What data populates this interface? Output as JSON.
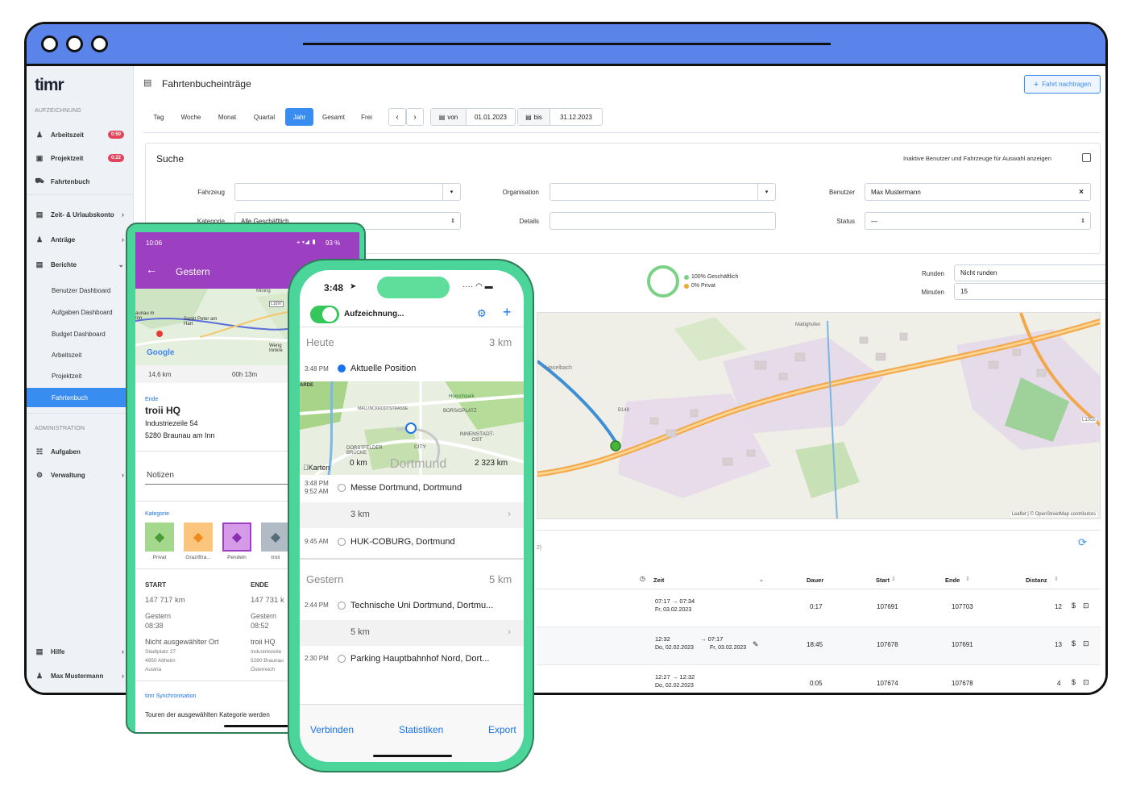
{
  "sidebar": {
    "logo": "timr",
    "section_recording": "AUFZEICHNUNG",
    "items": [
      {
        "label": "Arbeitszeit",
        "badge": "0:50"
      },
      {
        "label": "Projektzeit",
        "badge": "0:22"
      },
      {
        "label": "Fahrtenbuch"
      },
      {
        "label": "Zeit- & Urlaubskonto"
      },
      {
        "label": "Anträge"
      },
      {
        "label": "Berichte"
      }
    ],
    "report_items": [
      "Benutzer Dashboard",
      "Aufgaben Dashboard",
      "Budget Dashboard",
      "Arbeitszeit",
      "Projektzeit",
      "Fahrtenbuch"
    ],
    "section_admin": "ADMINISTRATION",
    "admin_items": [
      "Aufgaben",
      "Verwaltung"
    ],
    "help": "Hilfe",
    "user": "Max Mustermann"
  },
  "header": {
    "title": "Fahrtenbucheinträge",
    "add_button": "Fahrt nachtragen"
  },
  "period_tabs": [
    "Tag",
    "Woche",
    "Monat",
    "Quartal",
    "Jahr",
    "Gesamt",
    "Frei"
  ],
  "active_tab": "Jahr",
  "date_range": {
    "from_label": "von",
    "from": "01.01.2023",
    "to_label": "bis",
    "to": "31.12.2023"
  },
  "search": {
    "title": "Suche",
    "inactive_label": "Inaktive Benutzer und Fahrzeuge für Auswahl anzeigen",
    "vehicle_label": "Fahrzeug",
    "category_label": "Kategorie",
    "category_value": "Alle Geschäftlich",
    "organisation_label": "Organisation",
    "details_label": "Details",
    "user_label": "Benutzer",
    "user_value": "Max Mustermann",
    "status_label": "Status",
    "status_value": "—"
  },
  "summary": {
    "business": "100% Geschäftlich",
    "private": "0% Privat",
    "rounding_label": "Runden",
    "rounding_value": "Nicht runden",
    "minutes_label": "Minuten",
    "minutes_value": "15"
  },
  "map": {
    "labels": [
      "Haselbach",
      "Mattighofen",
      "Weng",
      "Innkreis",
      "B148",
      "L1055"
    ],
    "attribution": "Leaflet | © OpenStreetMap contributors"
  },
  "table": {
    "count_suffix": "2)",
    "columns": [
      "Zeit",
      "Dauer",
      "Start",
      "Ende",
      "Distanz"
    ],
    "rows": [
      {
        "time": "07:17 → 07:34",
        "date": "Fr, 03.02.2023",
        "duration": "0:17",
        "start": "107691",
        "end": "107703",
        "distance": "12"
      },
      {
        "time": "12:32",
        "time_end": "→ 07:17",
        "date": "Do, 02.02.2023",
        "date_end": "Fr, 03.02.2023",
        "duration": "18:45",
        "start": "107678",
        "end": "107691",
        "distance": "13"
      },
      {
        "time": "12:27 → 12:32",
        "date": "Do, 02.02.2023",
        "duration": "0:05",
        "start": "107674",
        "end": "107678",
        "distance": "4"
      }
    ]
  },
  "android": {
    "status_time": "10:06",
    "battery": "93 %",
    "title": "Gestern",
    "map_labels": [
      "Mining",
      "L1097",
      "Sankt Peter am Hart",
      "aunau m Inn",
      "Weng Innkre",
      "Google"
    ],
    "distance": "14,6 km",
    "duration": "00h 13m",
    "end_label": "Ende",
    "end_place": "troii HQ",
    "end_address1": "Industriezeile 54",
    "end_address2": "5280 Braunau am Inn",
    "notes_label": "Notizen",
    "category_label": "Kategorie",
    "categories": [
      "Privat",
      "Graz/Bra...",
      "Pendeln",
      "troii"
    ],
    "start_label": "START",
    "end_col_label": "ENDE",
    "start_km": "147 717 km",
    "end_km": "147 731 k",
    "start_day": "Gestern",
    "start_time": "08:38",
    "end_day": "Gestern",
    "end_time": "08:52",
    "start_place": "Nicht ausgewählter Ort",
    "start_addr": [
      "Stadtplatz 27",
      "4950 Altheim",
      "Austria"
    ],
    "end_place2": "troii HQ",
    "end_addr": [
      "Industriezeile",
      "5280 Braunau",
      "Österreich"
    ],
    "sync_label": "timr Synchronisation",
    "sync_text": "Touren der ausgewählten Kategorie werden"
  },
  "iphone": {
    "status_time": "3:48",
    "recording_label": "Aufzeichnung...",
    "today_label": "Heute",
    "today_km": "3 km",
    "current_time": "3:48 PM",
    "current_label": "Aktuelle Position",
    "map_labels": [
      "ARDE",
      "Hoeschpark",
      "MALLINCKRODTSTRASSE",
      "BORSIGPLATZ",
      "INNENSTADT-OST",
      "DORSTFELDER BRÜCKE",
      "CITY",
      "Dortmund"
    ],
    "map_brand": "Karten",
    "odometer_start": "0 km",
    "odometer_end": "2 323 km",
    "trip1_time1": "3:48 PM",
    "trip1_time2": "9:52 AM",
    "trip1_place": "Messe Dortmund, Dortmund",
    "trip1_km": "3 km",
    "trip1_start_time": "9:45 AM",
    "trip1_start_place": "HUK-COBURG, Dortmund",
    "yesterday_label": "Gestern",
    "yesterday_km": "5 km",
    "trip2_time": "2:44 PM",
    "trip2_place": "Technische Uni Dortmund, Dortmu...",
    "trip2_km": "5 km",
    "trip2_start_time": "2:30 PM",
    "trip2_start_place": "Parking Hauptbahnhof Nord, Dort...",
    "tabs": [
      "Verbinden",
      "Statistiken",
      "Export"
    ]
  }
}
